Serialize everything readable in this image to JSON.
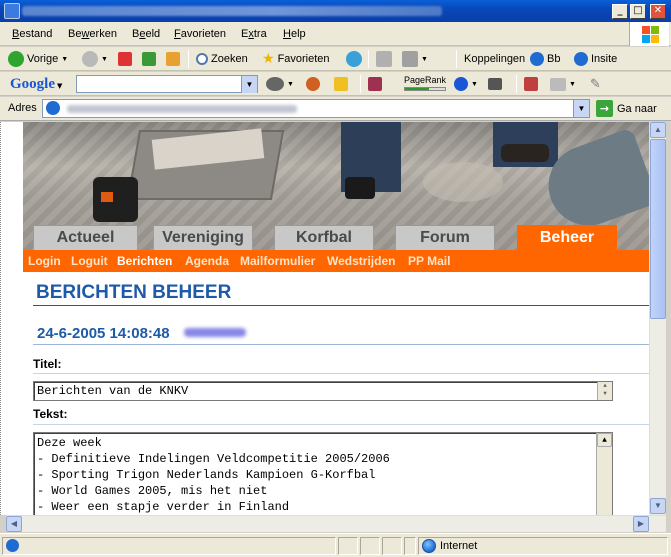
{
  "window": {
    "minimize": "_",
    "maximize": "□",
    "close": "✕"
  },
  "menu": [
    "Bestand",
    "Bewerken",
    "Beeld",
    "Favorieten",
    "Extra",
    "Help"
  ],
  "toolbar": {
    "back_label": "Vorige",
    "search_label": "Zoeken",
    "favorites_label": "Favorieten",
    "links_label": "Koppelingen",
    "link1": "Bb",
    "link2": "Insite"
  },
  "googlebar": {
    "logo": "Google",
    "pagerank_label": "PageRank"
  },
  "address": {
    "label": "Adres",
    "go_label": "Ga naar"
  },
  "site": {
    "tabs": [
      "Actueel",
      "Vereniging",
      "Korfbal",
      "Forum",
      "Beheer"
    ],
    "active_tab": "Beheer",
    "subnav": [
      "Login",
      "Loguit",
      "Berichten",
      "Agenda",
      "Mailformulier",
      "Wedstrijden",
      "PP Mail"
    ],
    "active_subnav": "Berichten",
    "page_title": "BERICHTEN BEHEER",
    "timestamp": "24-6-2005 14:08:48",
    "titel_label": "Titel:",
    "titel_value": "Berichten van de KNKV",
    "tekst_label": "Tekst:",
    "tekst_lines": [
      "Deze week",
      "- Definitieve Indelingen Veldcompetitie 2005/2006",
      "- Sporting Trigon Nederlands Kampioen G-Korfbal",
      "- World Games 2005, mis het niet",
      "- Weer een stapje verder in Finland"
    ]
  },
  "status": {
    "zone": "Internet"
  },
  "colors": {
    "accent_orange": "#ff6600",
    "heading_blue": "#1d5aa8"
  }
}
